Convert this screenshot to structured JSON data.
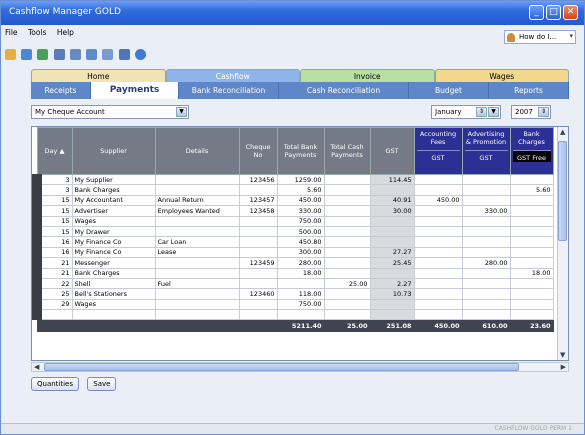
{
  "window": {
    "title": "Cashflow Manager GOLD"
  },
  "menu": [
    "File",
    "Tools",
    "Help"
  ],
  "help_box": "How do I...",
  "tabs_top": [
    "Home",
    "Cashflow",
    "Invoice",
    "Wages"
  ],
  "tabs_top_colors": [
    "#f1e3b4",
    "#8fb4ea",
    "#b8e0a4",
    "#f2d88a"
  ],
  "tabs_sub": [
    "Receipts",
    "Payments",
    "Bank Reconciliation",
    "Cash Reconciliation",
    "Budget",
    "Reports"
  ],
  "account": "My Cheque Account",
  "month": "January",
  "year": "2007",
  "columns": [
    "Day",
    "Supplier",
    "Details",
    "Cheque No",
    "Total Bank Payments",
    "Total Cash Payments",
    "GST",
    "Accounting Fees",
    "Advertising & Promotion",
    "Bank Charges"
  ],
  "column_sub": [
    "GST",
    "GST",
    "GST Free"
  ],
  "rows": [
    [
      "3",
      "My Supplier",
      "",
      "123456",
      "1259.00",
      "",
      "114.45",
      "",
      "",
      ""
    ],
    [
      "3",
      "Bank Charges",
      "",
      "",
      "5.60",
      "",
      "",
      "",
      "",
      "5.60"
    ],
    [
      "15",
      "My Accountant",
      "Annual Return",
      "123457",
      "450.00",
      "",
      "40.91",
      "450.00",
      "",
      ""
    ],
    [
      "15",
      "Advertiser",
      "Employees Wanted",
      "123458",
      "330.00",
      "",
      "30.00",
      "",
      "330.00",
      ""
    ],
    [
      "15",
      "Wages",
      "",
      "",
      "750.00",
      "",
      "",
      "",
      "",
      ""
    ],
    [
      "15",
      "My Drawer",
      "",
      "",
      "500.00",
      "",
      "",
      "",
      "",
      ""
    ],
    [
      "16",
      "My Finance Co",
      "Car Loan",
      "",
      "450.80",
      "",
      "",
      "",
      "",
      ""
    ],
    [
      "16",
      "My Finance Co",
      "Lease",
      "",
      "300.00",
      "",
      "27.27",
      "",
      "",
      ""
    ],
    [
      "21",
      "Messenger",
      "",
      "123459",
      "280.00",
      "",
      "25.45",
      "",
      "280.00",
      ""
    ],
    [
      "21",
      "Bank Charges",
      "",
      "",
      "18.00",
      "",
      "",
      "",
      "",
      "18.00"
    ],
    [
      "22",
      "Shell",
      "Fuel",
      "",
      "",
      "25.00",
      "2.27",
      "",
      "",
      ""
    ],
    [
      "25",
      "Bell's Stationers",
      "",
      "123460",
      "118.00",
      "",
      "10.73",
      "",
      "",
      ""
    ],
    [
      "29",
      "Wages",
      "",
      "",
      "750.00",
      "",
      "",
      "",
      "",
      ""
    ],
    [
      "",
      "",
      "",
      "",
      "",
      "",
      "",
      "",
      "",
      ""
    ]
  ],
  "totals": [
    "",
    "",
    "",
    "",
    "5211.40",
    "25.00",
    "251.08",
    "450.00",
    "610.00",
    "23.60"
  ],
  "buttons": [
    "Quantities",
    "Save"
  ],
  "status_text": "CASHFLOW GOLD PERM 1"
}
